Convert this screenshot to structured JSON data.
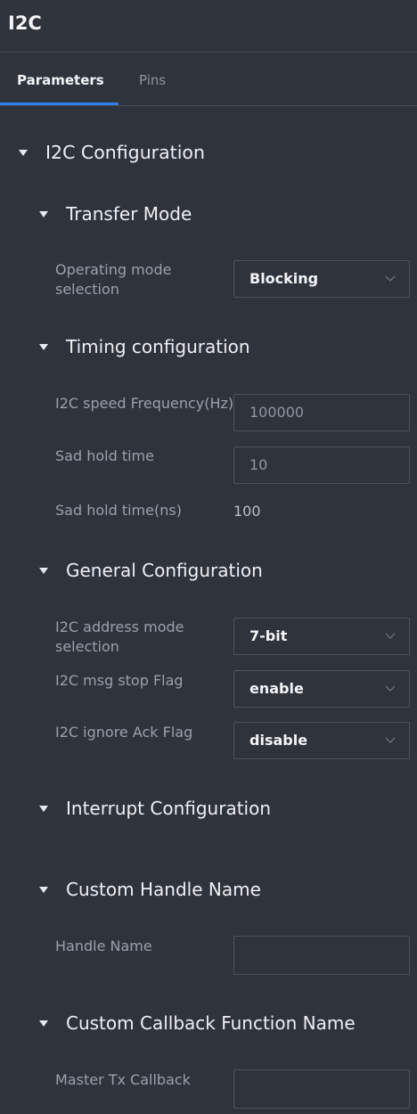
{
  "header": {
    "title": "I2C"
  },
  "tabs": [
    {
      "label": "Parameters",
      "active": true
    },
    {
      "label": "Pins",
      "active": false
    }
  ],
  "config": {
    "title": "I2C Configuration",
    "transfer_mode": {
      "title": "Transfer Mode",
      "operating_mode": {
        "label_line1": "Operating mode",
        "label_line2": "selection",
        "value": "Blocking"
      }
    },
    "timing": {
      "title": "Timing configuration",
      "speed": {
        "label": "I2C speed Frequency(Hz)",
        "value": "100000"
      },
      "sad_hold": {
        "label": "Sad hold time",
        "value": "10"
      },
      "sad_hold_ns": {
        "label": "Sad hold time(ns)",
        "value": "100"
      }
    },
    "general": {
      "title": "General Configuration",
      "address_mode": {
        "label_line1": "I2C address mode",
        "label_line2": "selection",
        "value": "7-bit"
      },
      "msg_stop": {
        "label": "I2C msg stop Flag",
        "value": "enable"
      },
      "ignore_ack": {
        "label": "I2C ignore Ack Flag",
        "value": "disable"
      }
    },
    "interrupt": {
      "title": "Interrupt Configuration"
    },
    "handle": {
      "title": "Custom Handle Name",
      "handle_name": {
        "label": "Handle Name",
        "value": ""
      }
    },
    "callback": {
      "title": "Custom Callback Function Name",
      "master_tx": {
        "label": "Master Tx Callback",
        "value": ""
      }
    }
  },
  "colors": {
    "background": "#2f333b",
    "accent": "#2f80ed",
    "border": "#4c525c"
  },
  "icons": {
    "caret": "caret-down-icon",
    "chevron": "chevron-down-icon"
  }
}
